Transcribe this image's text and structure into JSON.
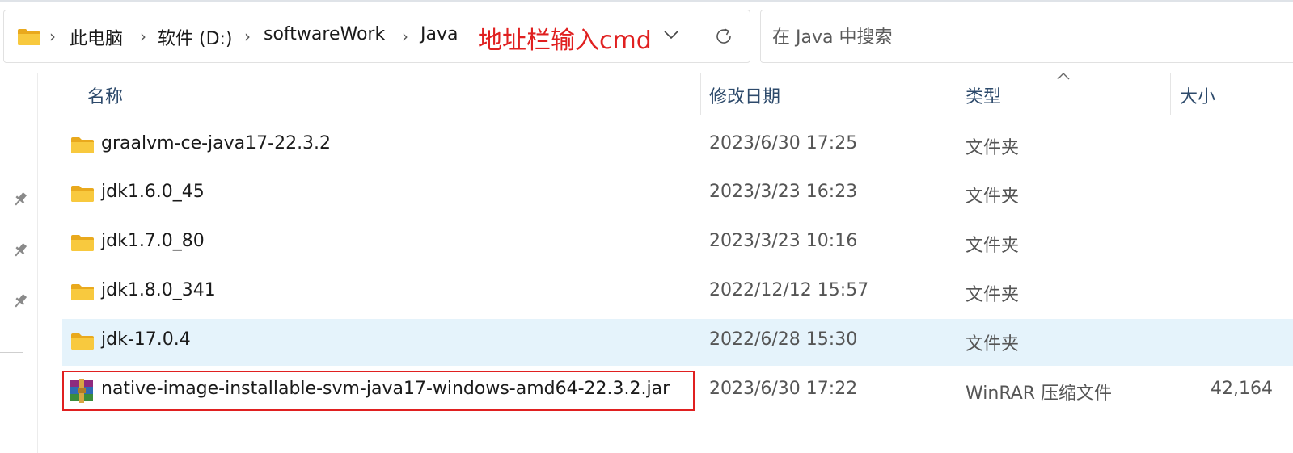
{
  "address_bar": {
    "breadcrumbs": [
      "此电脑",
      "软件 (D:)",
      "softwareWork",
      "Java"
    ],
    "annotation": "地址栏输入cmd"
  },
  "search": {
    "placeholder": "在 Java 中搜索"
  },
  "columns": {
    "name": "名称",
    "date": "修改日期",
    "type": "类型",
    "size": "大小"
  },
  "files": [
    {
      "name": "graalvm-ce-java17-22.3.2",
      "date": "2023/6/30 17:25",
      "type": "文件夹",
      "size": "",
      "icon": "folder-icon"
    },
    {
      "name": "jdk1.6.0_45",
      "date": "2023/3/23 16:23",
      "type": "文件夹",
      "size": "",
      "icon": "folder-icon"
    },
    {
      "name": "jdk1.7.0_80",
      "date": "2023/3/23 10:16",
      "type": "文件夹",
      "size": "",
      "icon": "folder-icon"
    },
    {
      "name": "jdk1.8.0_341",
      "date": "2022/12/12 15:57",
      "type": "文件夹",
      "size": "",
      "icon": "folder-icon"
    },
    {
      "name": "jdk-17.0.4",
      "date": "2022/6/28 15:30",
      "type": "文件夹",
      "size": "",
      "icon": "folder-icon",
      "selected": true
    },
    {
      "name": "native-image-installable-svm-java17-windows-amd64-22.3.2.jar",
      "date": "2023/6/30 17:22",
      "type": "WinRAR 压缩文件",
      "size": "42,164",
      "icon": "winrar-archive-icon",
      "highlighted": true
    }
  ],
  "colors": {
    "annotation": "#e02020",
    "selection": "#e5f3fb",
    "header_text": "#2d4a6b",
    "folder": "#f8c93e"
  }
}
